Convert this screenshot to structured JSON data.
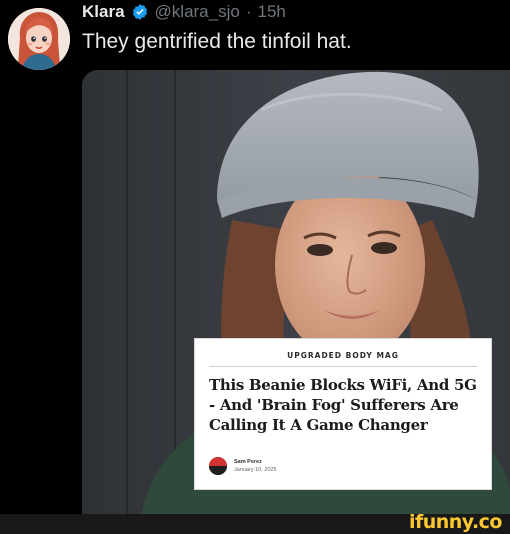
{
  "tweet": {
    "display_name": "Klara",
    "verified": true,
    "handle": "@klara_sjo",
    "separator": "·",
    "time_ago": "15h",
    "text": "They gentrified the tinfoil hat."
  },
  "media": {
    "article": {
      "publication": "UPGRADED BODY MAG",
      "headline": "This Beanie Blocks WiFi, And 5G - And 'Brain Fog' Sufferers Are Calling It A Game Changer",
      "author": "Sam Perez",
      "date": "January 10, 2025"
    }
  },
  "colors": {
    "background": "#000000",
    "text_primary": "#e7e9ea",
    "text_secondary": "#71767b",
    "verified_badge": "#1d9bf0",
    "watermark": "#fdc82f",
    "beanie": "#a9afb5",
    "sweater": "#2f4a3c"
  },
  "icons": {
    "verified": "verified-badge-icon"
  },
  "watermark": "ifunny.co"
}
